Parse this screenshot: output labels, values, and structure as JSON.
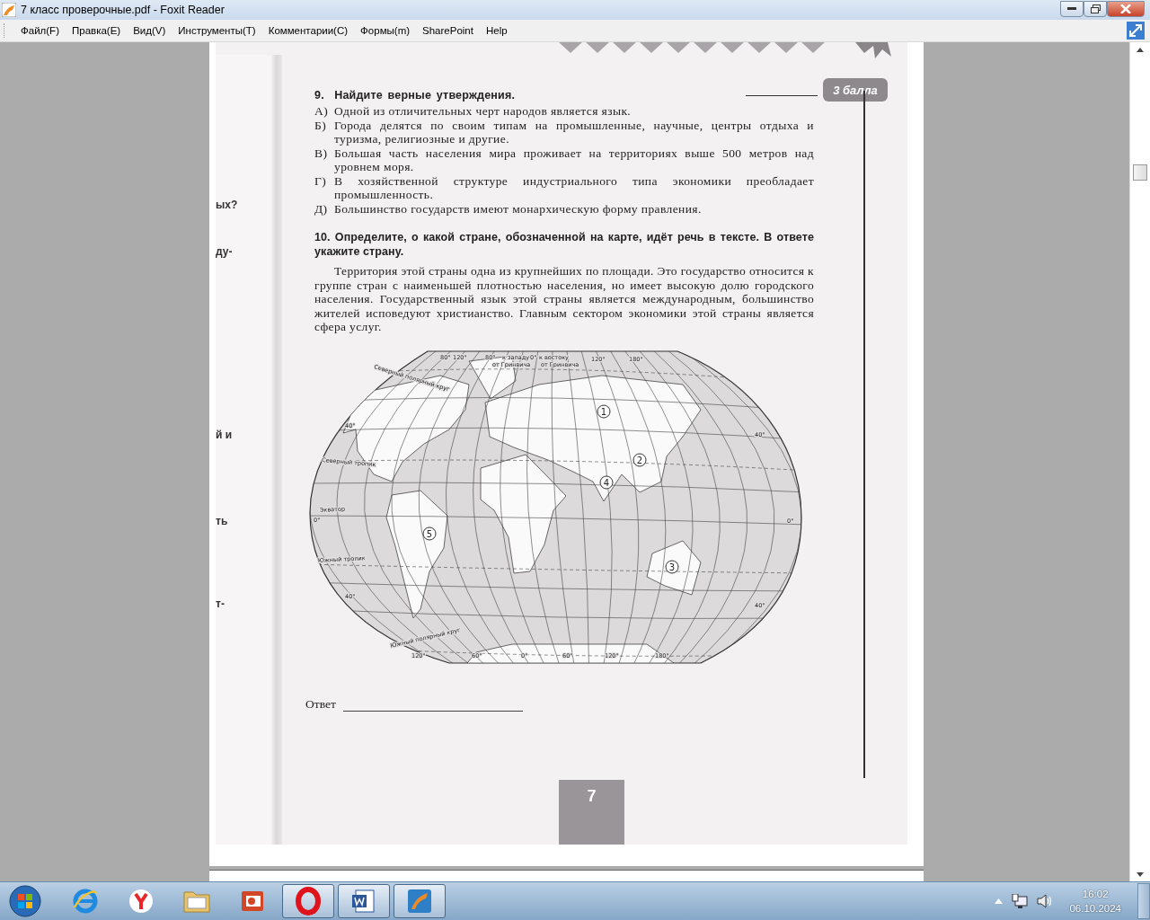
{
  "window": {
    "title": "7 класс проверочные.pdf - Foxit Reader"
  },
  "menu": [
    {
      "label": "Файл(F)"
    },
    {
      "label": "Правка(E)"
    },
    {
      "label": "Вид(V)"
    },
    {
      "label": "Инструменты(T)"
    },
    {
      "label": "Комментарии(C)"
    },
    {
      "label": "Формы(m)"
    },
    {
      "label": "SharePoint"
    },
    {
      "label": "Help"
    }
  ],
  "document": {
    "margin_fragments": [
      "ых?",
      "ду-",
      "й и",
      "ть",
      "т-"
    ],
    "score_badge": "3 балла",
    "question_9": {
      "number": "9.",
      "title": "Найдите верные утверждения.",
      "options": [
        {
          "letter": "А)",
          "text": "Одной из отличительных черт народов является язык."
        },
        {
          "letter": "Б)",
          "text": "Города делятся по своим типам на промышленные, научные, центры отдыха и туризма, религиозные и другие."
        },
        {
          "letter": "В)",
          "text": "Большая часть населения мира проживает на территориях выше 500 метров над уровнем моря."
        },
        {
          "letter": "Г)",
          "text": "В хозяйственной структуре индустриального типа экономики преобладает промышленность."
        },
        {
          "letter": "Д)",
          "text": "Большинство государств имеют монархическую форму правления."
        }
      ]
    },
    "question_10": {
      "number": "10.",
      "title": "Определите, о какой стране, обозначенной на карте, идёт речь в тексте. В ответе укажите страну.",
      "text": "Территория этой страны одна из крупнейших по площади. Это государство относится к группе стран с наименьшей плотностью населения, но имеет высокую долю городского населения. Государственный язык этой страны является международным, большинство жителей исповедуют христианство. Главным сектором экономики этой страны является сфера услуг."
    },
    "map": {
      "labels": [
        "80°",
        "120°",
        "80°",
        "к западу",
        "0°",
        "к востоку",
        "от Гринвича",
        "от Гринвича",
        "120°",
        "180°",
        "Северный полярный круг",
        "40°",
        "Северный тропик",
        "0°",
        "Экватор",
        "Южный тропик",
        "40°",
        "Южный полярный круг",
        "120°",
        "60°",
        "0°",
        "60°",
        "120°",
        "180°",
        "40°",
        "0°",
        "40°"
      ],
      "markers": [
        "1",
        "2",
        "3",
        "4",
        "5"
      ]
    },
    "answer_label": "Ответ",
    "page_number": "7"
  },
  "taskbar": {
    "apps": [
      {
        "kind": "ie",
        "open": false
      },
      {
        "kind": "yandex",
        "open": false
      },
      {
        "kind": "folder",
        "open": false
      },
      {
        "kind": "presentation",
        "open": false
      },
      {
        "kind": "opera",
        "open": true
      },
      {
        "kind": "word",
        "open": true
      },
      {
        "kind": "foxit",
        "open": true
      }
    ],
    "tray": {
      "time": "16:02",
      "date": "06.10.2024"
    }
  }
}
